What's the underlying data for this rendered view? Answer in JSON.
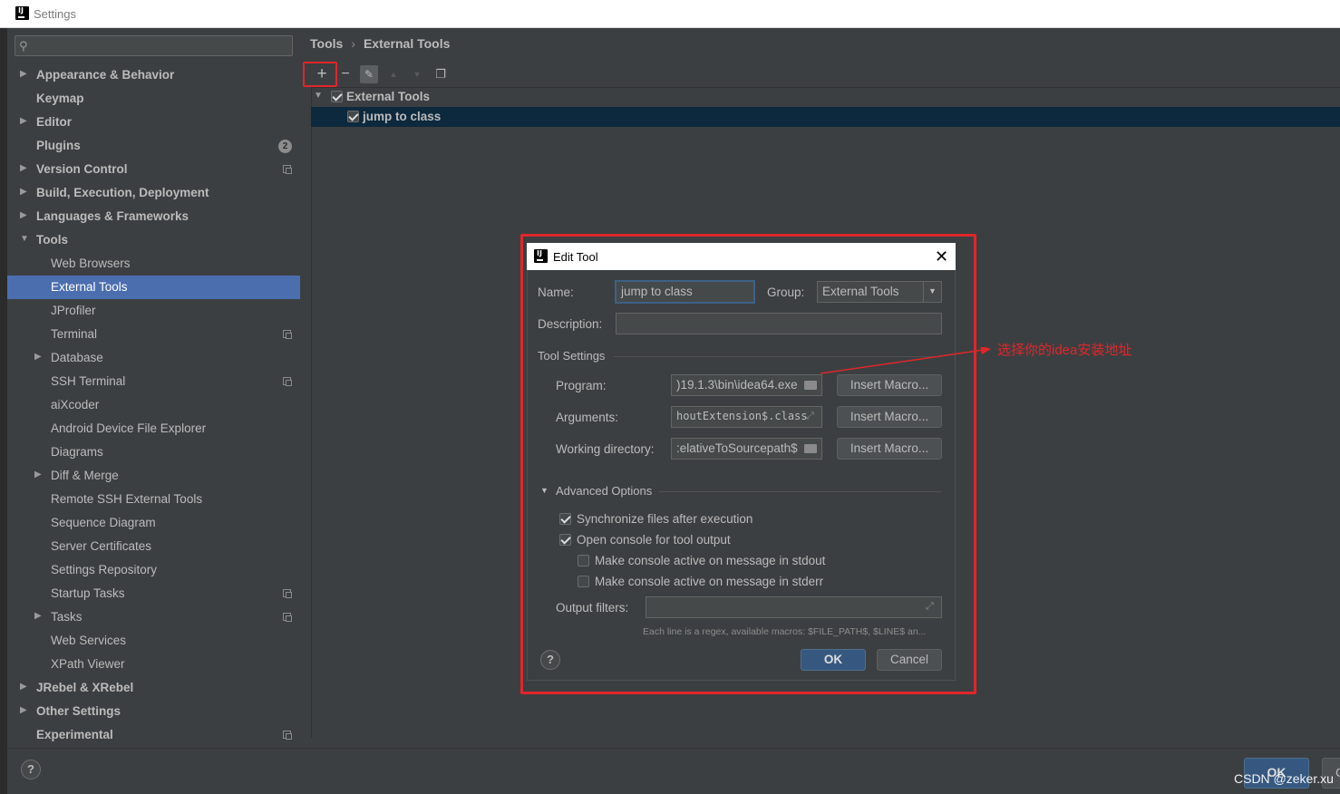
{
  "window": {
    "title": "Settings"
  },
  "sidebar": {
    "search_placeholder": "",
    "items": [
      {
        "label": "Appearance & Behavior"
      },
      {
        "label": "Keymap"
      },
      {
        "label": "Editor"
      },
      {
        "label": "Plugins",
        "badge": "2"
      },
      {
        "label": "Version Control"
      },
      {
        "label": "Build, Execution, Deployment"
      },
      {
        "label": "Languages & Frameworks"
      },
      {
        "label": "Tools"
      },
      {
        "label": "Web Browsers"
      },
      {
        "label": "External Tools"
      },
      {
        "label": "JProfiler"
      },
      {
        "label": "Terminal"
      },
      {
        "label": "Database"
      },
      {
        "label": "SSH Terminal"
      },
      {
        "label": "aiXcoder"
      },
      {
        "label": "Android Device File Explorer"
      },
      {
        "label": "Diagrams"
      },
      {
        "label": "Diff & Merge"
      },
      {
        "label": "Remote SSH External Tools"
      },
      {
        "label": "Sequence Diagram"
      },
      {
        "label": "Server Certificates"
      },
      {
        "label": "Settings Repository"
      },
      {
        "label": "Startup Tasks"
      },
      {
        "label": "Tasks"
      },
      {
        "label": "Web Services"
      },
      {
        "label": "XPath Viewer"
      },
      {
        "label": "JRebel & XRebel"
      },
      {
        "label": "Other Settings"
      },
      {
        "label": "Experimental"
      }
    ]
  },
  "breadcrumb": {
    "parent": "Tools",
    "separator": "›",
    "current": "External Tools"
  },
  "toolbar": {
    "add": "+",
    "remove": "−",
    "up": "▲",
    "down": "▼"
  },
  "tools_tree": {
    "group_label": "External Tools",
    "tool_label": "jump to class"
  },
  "dialog": {
    "title": "Edit Tool",
    "name_label": "Name:",
    "name_value": "jump to class",
    "group_label": "Group:",
    "group_value": "External Tools",
    "description_label": "Description:",
    "description_value": "",
    "tool_settings_label": "Tool Settings",
    "program_label": "Program:",
    "program_value": ")19.1.3\\bin\\idea64.exe",
    "arguments_label": "Arguments:",
    "arguments_value": "houtExtension$.class",
    "workdir_label": "Working directory:",
    "workdir_value": ":elativeToSourcepath$",
    "insert_macro": "Insert Macro...",
    "advanced_label": "Advanced Options",
    "sync_files": "Synchronize files after execution",
    "open_console": "Open console for tool output",
    "console_stdout": "Make console active on message in stdout",
    "console_stderr": "Make console active on message in stderr",
    "output_filters_label": "Output filters:",
    "output_filters_value": "",
    "hint": "Each line is a regex, available macros: $FILE_PATH$, $LINE$ an...",
    "ok": "OK",
    "cancel": "Cancel",
    "help": "?"
  },
  "annotation": {
    "text": "选择你的idea安装地址",
    "color": "#e0262a"
  },
  "footer": {
    "help": "?",
    "ok": "OK",
    "cancel_partial": "C",
    "watermark": "CSDN @zeker.xu"
  },
  "colors": {
    "selection": "#4b6eaf",
    "tree_selection": "#0d293e",
    "primary_button": "#365880",
    "annotation_red": "#e0262a"
  }
}
